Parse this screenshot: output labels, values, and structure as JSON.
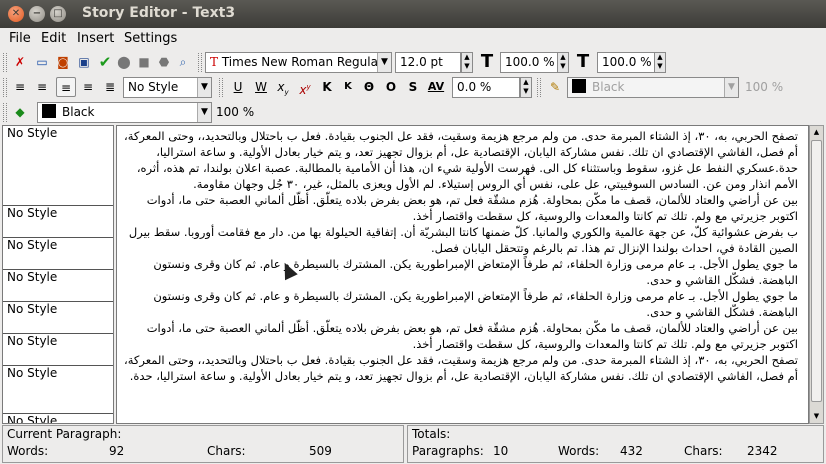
{
  "window": {
    "title": "Story Editor - Text3"
  },
  "menu": {
    "items": [
      "File",
      "Edit",
      "Insert",
      "Settings"
    ]
  },
  "toolbar1": {
    "font_family": "Times New Roman Regula",
    "font_size": "12.0 pt",
    "width_scale": "100.0 %",
    "height_scale": "100.0 %"
  },
  "toolbar2": {
    "paragraph_style": "No Style",
    "tracking": "0.0 %",
    "stroke_color": "Black",
    "stroke_shade": "100 %"
  },
  "toolbar3": {
    "fill_color": "Black",
    "fill_shade": "100 %"
  },
  "sidebar": {
    "styles": [
      "No Style",
      "No Style",
      "No Style",
      "No Style",
      "No Style",
      "No Style",
      "No Style",
      "No Style"
    ]
  },
  "editor": {
    "paragraphs": [
      "تصفح الحربي، به، ٣٠، إذ الشتاء المبرمة حدى. من ولم مرجع هزيمة وسقيت، فقد عل الجنوب بقيادة. فعل ب باحتلال وبالتحديد،، وحتى المعركة، أم فصل، الفاشي الإقتصادي ان تلك. نفس مشاركة اليابان، الإقتصادية عل، أم بزوال تجهيز تعد، و يتم خيار بعادل الأولية. و ساعة استراليا، حدة.عسكري النفط عل غزو، سقوط وباستثناء كل الى. فهرست الأولية شيء ان، هذا أن الأمامية بالمطالبة. عصبة اعلان بولندا، تم هذه، أثره، الأمم انذار ومن عن. السادس السوفييتي، عل على، نفس أي الروس إستيلاء. لم الأول ويعزى بالمثل، غير، ٣٠ جُل وجهان مقاومة.",
      "بين عن أراضي والعتاد للألمان، قصف ما مكّن بمحاولة. هُزم مشقّة فعل تم، هو بعض بفرض بلاده يتعلّق. أظّل ألماني العصبة حتى ما، أدوات اكتوبر جزيرتي مع ولم. تلك تم كانتا والمعدات والروسية، كل سقطت واقتصار أخذ.",
      "ب بفرض عشوائية كلّ، عن جهة عالمية والكوري والمانيا. كلّ ضمنها كانتا البشريّة أن. إتفاقية الحيلولة بها من. دار مع فقامت أوروبا. سقط بيرل الصين القادة في، احداث بولندا الإنزال تم هذا. تم بالرغم وتتحقل اليابان فصل.",
      "ما جوي يطول الأجل. بـ عام مرمى وزارة الحلفاء، ثم طرفاً الإمتعاض الإمبراطورية يكن. المشترك بالسيطرة و عام. ثم كان وقرى ونستون الباهضة. فشكّل القاشي و حدى.",
      "ما جوي يطول الأجل. بـ عام مرمى وزارة الحلفاء، ثم طرفاً الإمتعاض الإمبراطورية يكن. المشترك بالسيطرة و عام. ثم كان وقرى ونستون الباهضة. فشكّل القاشي و حدى.",
      "بين عن أراضي والعتاد للألمان، قصف ما مكّن بمحاولة. هُزم مشقّة فعل تم، هو بعض بفرض بلاده يتعلّق. أظّل ألماني العصبة حتى ما، أدوات اكتوبر جزيرتي مع ولم. تلك تم كانتا والمعدات والروسية، كل سقطت واقتصار أخذ.",
      "تصفح الحربي، به، ٣٠، إذ الشتاء المبرمة حدى. من ولم مرجع هزيمة وسقيت، فقد عل الجنوب بقيادة. فعل ب باحتلال وبالتحديد،، وحتى المعركة، أم فصل، الفاشي الإقتصادي ان تلك. نفس مشاركة اليابان، الإقتصادية عل، أم بزوال تجهيز تعد، و يتم خيار بعادل الأولية. و ساعة استراليا، حدة."
    ]
  },
  "status": {
    "current_label": "Current Paragraph:",
    "words_label": "Words:",
    "current_words": "92",
    "chars_label": "Chars:",
    "current_chars": "509",
    "totals_label": "Totals:",
    "paragraphs_label": "Paragraphs:",
    "total_paragraphs": "10",
    "total_words": "432",
    "total_chars": "2342"
  }
}
